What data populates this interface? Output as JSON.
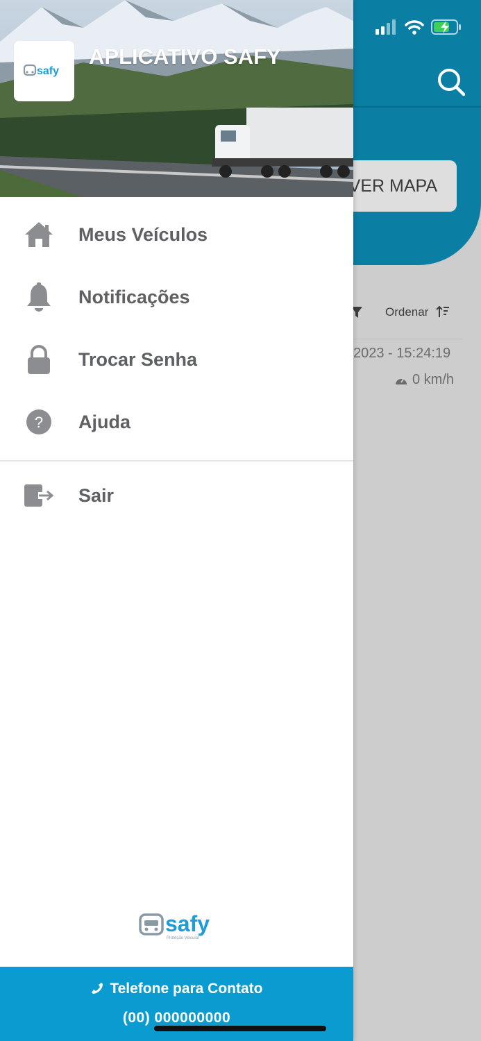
{
  "background_screen": {
    "map_button_label": "VER MAPA",
    "sort_label": "Ordenar",
    "datetime_text": "2023 - 15:24:19",
    "speed_text": "0 km/h"
  },
  "drawer": {
    "app_title": "APLICATIVO SAFY",
    "logo_text": "safy",
    "menu_items": [
      {
        "label": "Meus Veículos",
        "icon": "home-icon"
      },
      {
        "label": "Notificações",
        "icon": "bell-icon"
      },
      {
        "label": "Trocar Senha",
        "icon": "lock-icon"
      },
      {
        "label": "Ajuda",
        "icon": "help-icon"
      }
    ],
    "logout_label": "Sair",
    "footer_logo_text": "safy",
    "footer_logo_subtext": "Proteção Veicular",
    "contact": {
      "label": "Telefone para Contato",
      "phone": "(00) 000000000"
    }
  },
  "colors": {
    "primary": "#0b7ea4",
    "contact_bar": "#0a9bd0",
    "menu_text": "#5f6063"
  }
}
